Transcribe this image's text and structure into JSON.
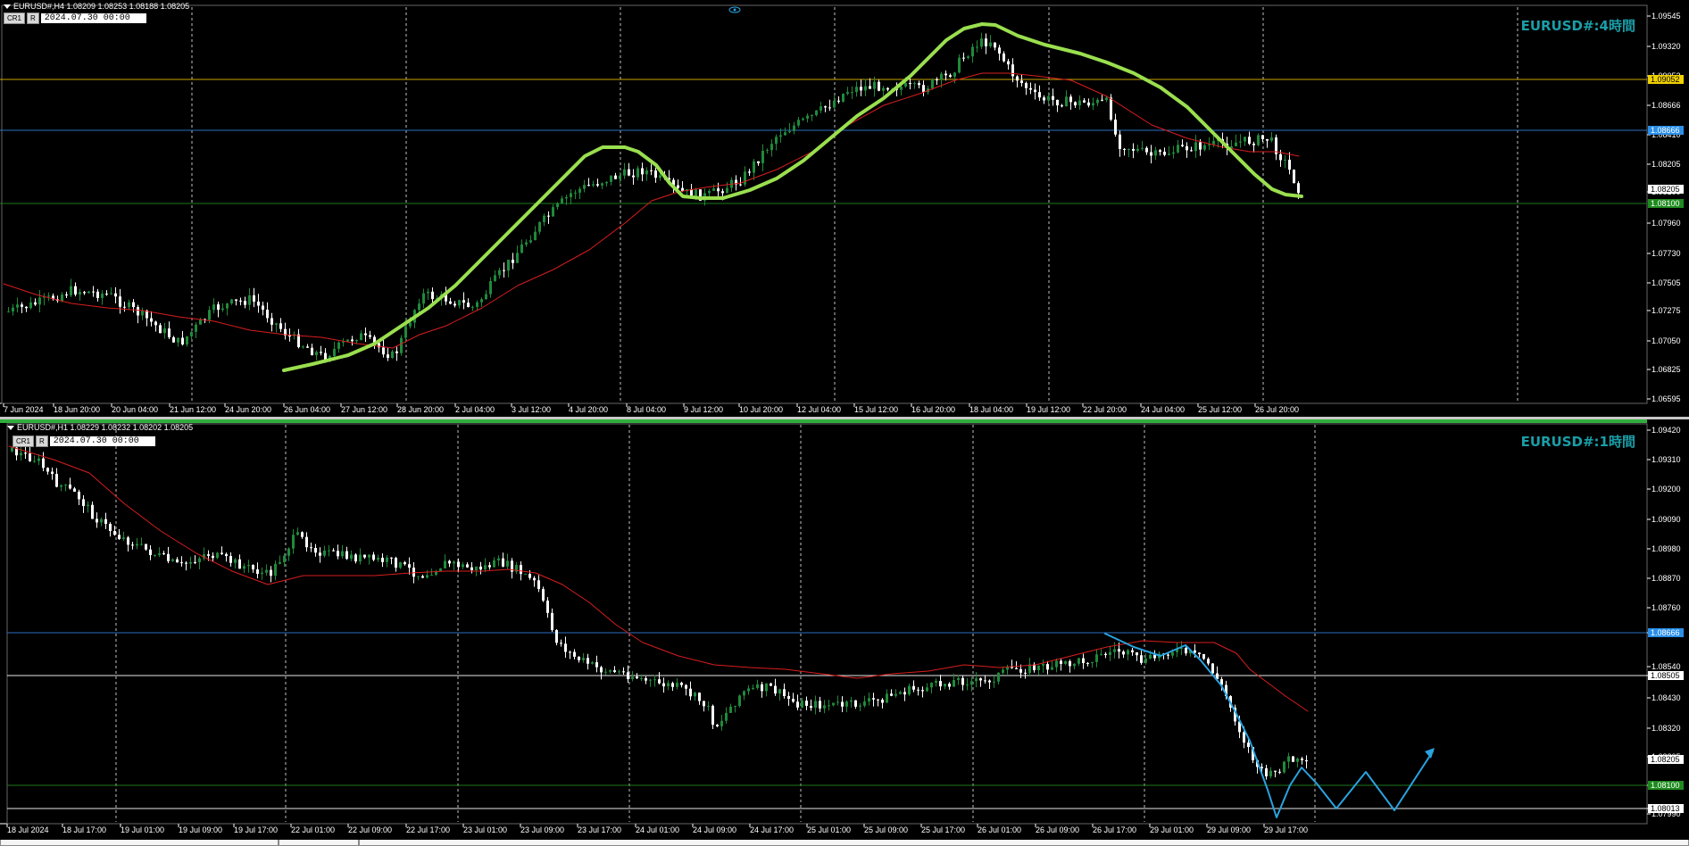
{
  "colors": {
    "background": "#000000",
    "grid": "#c0c0c0",
    "bull_candle": "#1f8a3b",
    "bear_candle": "#ffffff",
    "ma_line": "#d81e1e",
    "trend_curve": "#9adf4f",
    "projection": "#2aa3e0",
    "level_yellow": "#c8a400",
    "level_blue": "#2b6fc4",
    "level_green": "#1e7a1e",
    "level_white": "#e8e8e8",
    "title": "#1a9ea8"
  },
  "top": {
    "header": "EURUSD#,H4  1.08209 1.08253 1.08188 1.08205",
    "title": "EURUSD#:4時間",
    "buttons": [
      "CR1",
      "R"
    ],
    "date": "2024.07.30 00:00",
    "price_labels": [
      "1.09545",
      "1.09320",
      "1.09052",
      "1.08666",
      "1.08410",
      "1.08205",
      "1.08100",
      "1.07960",
      "1.07730",
      "1.07505",
      "1.07275",
      "1.07050",
      "1.06825",
      "1.06595"
    ],
    "time_labels": [
      "7 Jun 2024",
      "18 Jun 20:00",
      "20 Jun 04:00",
      "21 Jun 12:00",
      "24 Jun 20:00",
      "26 Jun 04:00",
      "27 Jun 12:00",
      "28 Jun 20:00",
      "2 Jul 04:00",
      "3 Jul 12:00",
      "4 Jul 20:00",
      "8 Jul 04:00",
      "9 Jul 12:00",
      "10 Jul 20:00",
      "12 Jul 04:00",
      "15 Jul 12:00",
      "16 Jul 20:00",
      "18 Jul 04:00",
      "19 Jul 12:00",
      "22 Jul 20:00",
      "24 Jul 04:00",
      "25 Jul 12:00",
      "26 Jul 20:00"
    ],
    "level_tags": [
      {
        "label": "1.09052",
        "bg": "#f0d000",
        "fg": "#000000"
      },
      {
        "label": "1.08666",
        "bg": "#2b8fe8",
        "fg": "#ffffff"
      },
      {
        "label": "1.08205",
        "bg": "#ffffff",
        "fg": "#000000"
      },
      {
        "label": "1.08100",
        "bg": "#1e8a1e",
        "fg": "#ffffff"
      }
    ]
  },
  "bottom": {
    "header": "EURUSD#,H1  1.08229 1.08232 1.08202 1.08205",
    "title": "EURUSD#:1時間",
    "buttons": [
      "CR1",
      "R"
    ],
    "date": "2024.07.30 00:00",
    "price_labels": [
      "1.09420",
      "1.09310",
      "1.09200",
      "1.09090",
      "1.08980",
      "1.08870",
      "1.08760",
      "1.08666",
      "1.08540",
      "1.08505",
      "1.08430",
      "1.08320",
      "1.08205",
      "1.08100",
      "1.08013",
      "1.07990"
    ],
    "time_labels": [
      "18 Jul 2024",
      "18 Jul 17:00",
      "19 Jul 01:00",
      "19 Jul 09:00",
      "19 Jul 17:00",
      "22 Jul 01:00",
      "22 Jul 09:00",
      "22 Jul 17:00",
      "23 Jul 01:00",
      "23 Jul 09:00",
      "23 Jul 17:00",
      "24 Jul 01:00",
      "24 Jul 09:00",
      "24 Jul 17:00",
      "25 Jul 01:00",
      "25 Jul 09:00",
      "25 Jul 17:00",
      "26 Jul 01:00",
      "26 Jul 09:00",
      "26 Jul 17:00",
      "29 Jul 01:00",
      "29 Jul 09:00",
      "29 Jul 17:00"
    ],
    "level_tags": [
      {
        "label": "1.08666",
        "bg": "#2b8fe8",
        "fg": "#ffffff"
      },
      {
        "label": "1.08505",
        "bg": "#ffffff",
        "fg": "#000000"
      },
      {
        "label": "1.08205",
        "bg": "#ffffff",
        "fg": "#000000"
      },
      {
        "label": "1.08100",
        "bg": "#1e8a1e",
        "fg": "#ffffff"
      },
      {
        "label": "1.08013",
        "bg": "#ffffff",
        "fg": "#000000"
      }
    ]
  }
}
